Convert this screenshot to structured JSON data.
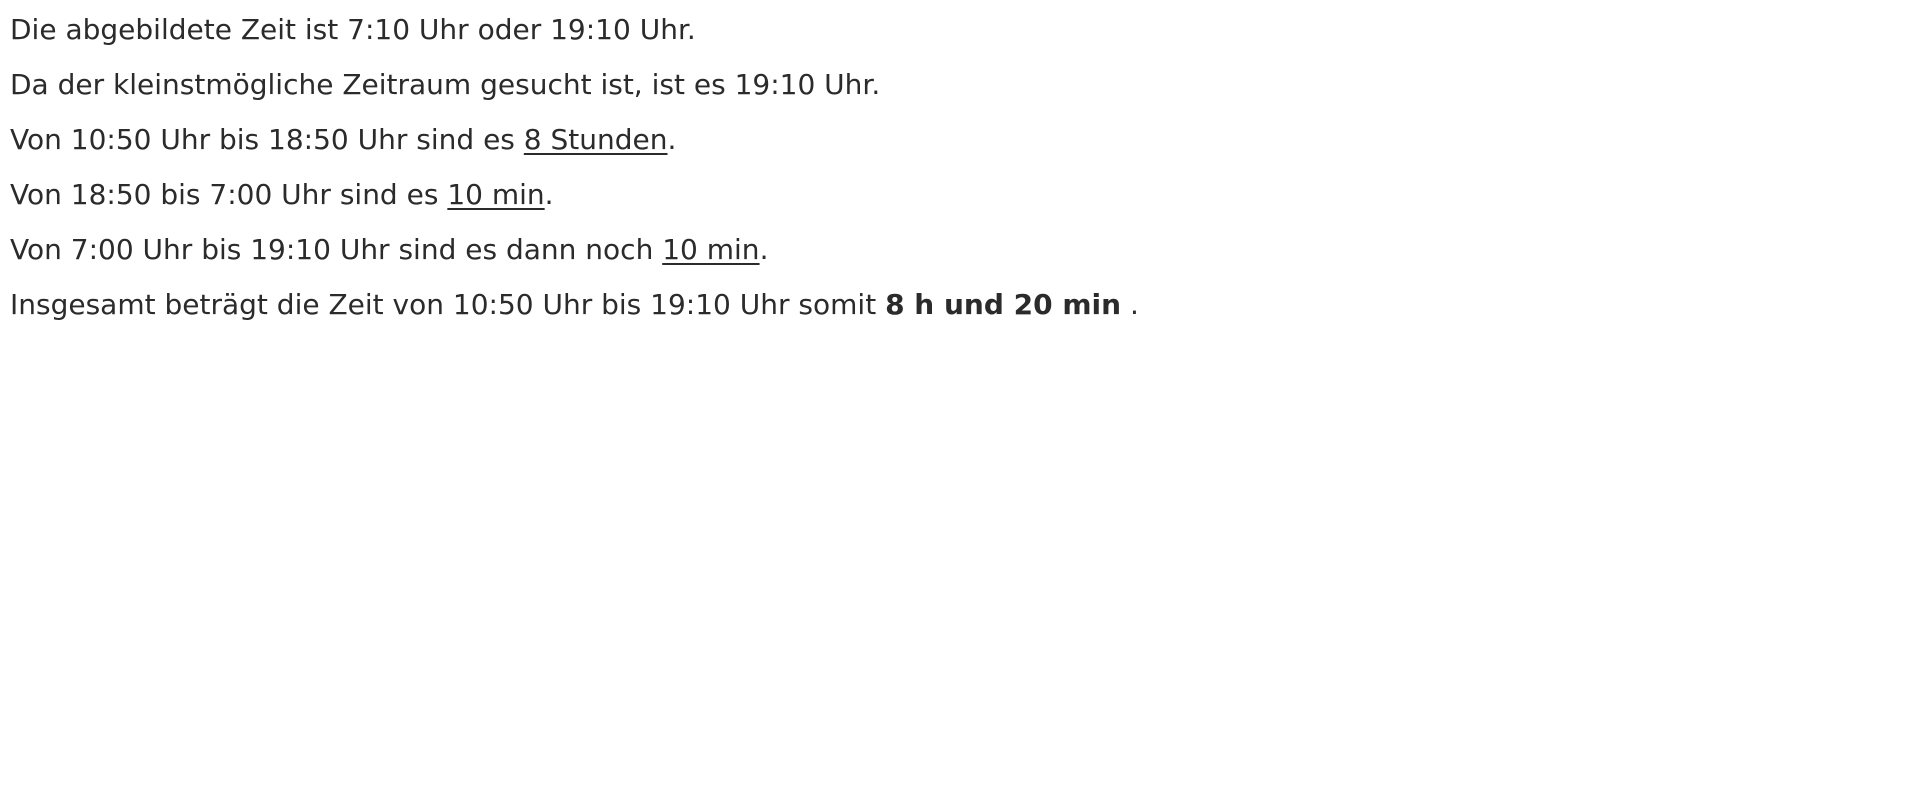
{
  "lines": [
    {
      "text": "Die abgebildete Zeit ist 7:10 Uhr oder 19:10 Uhr."
    },
    {
      "text": "Da der kleinstmögliche Zeitraum gesucht ist, ist es 19:10 Uhr."
    },
    {
      "pre": "Von 10:50 Uhr bis 18:50 Uhr sind es ",
      "highlight": "8 Stunden",
      "post": "."
    },
    {
      "pre": "Von 18:50 bis 7:00 Uhr sind es ",
      "highlight": "10 min",
      "post": "."
    },
    {
      "pre": "Von 7:00 Uhr bis 19:10 Uhr sind es dann noch ",
      "highlight": "10 min",
      "post": "."
    },
    {
      "pre": "Insgesamt beträgt die Zeit von 10:50 Uhr bis 19:10 Uhr somit ",
      "highlight": "8 h und 20 min",
      "post": " ."
    }
  ]
}
